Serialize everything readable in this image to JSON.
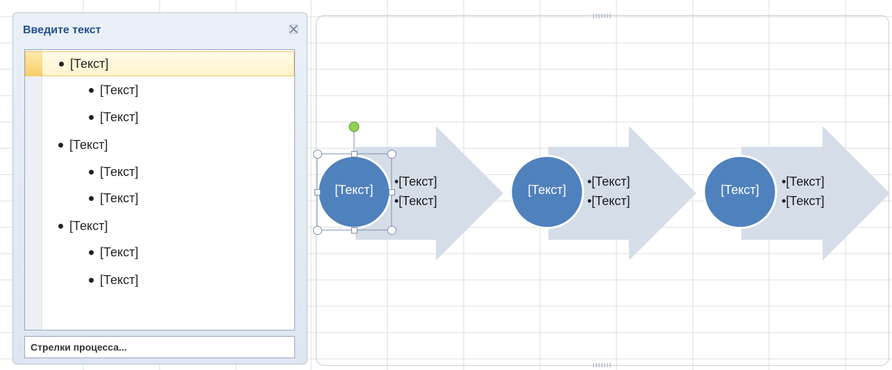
{
  "text_pane": {
    "title": "Введите текст",
    "close_icon": "close-x-icon",
    "items": [
      {
        "level": 1,
        "text": "[Текст]",
        "selected": true
      },
      {
        "level": 2,
        "text": "[Текст]"
      },
      {
        "level": 2,
        "text": "[Текст]"
      },
      {
        "level": 1,
        "text": "[Текст]"
      },
      {
        "level": 2,
        "text": "[Текст]"
      },
      {
        "level": 2,
        "text": "[Текст]"
      },
      {
        "level": 1,
        "text": "[Текст]"
      },
      {
        "level": 2,
        "text": "[Текст]"
      },
      {
        "level": 2,
        "text": "[Текст]"
      }
    ],
    "layout_name": "Стрелки процесса..."
  },
  "diagram": {
    "steps": [
      {
        "circle_text": "[Текст]",
        "lines": [
          "•[Текст]",
          "•[Текст]"
        ],
        "selected": true
      },
      {
        "circle_text": "[Текст]",
        "lines": [
          "•[Текст]",
          "•[Текст]"
        ]
      },
      {
        "circle_text": "[Текст]",
        "lines": [
          "•[Текст]",
          "•[Текст]"
        ]
      }
    ],
    "colors": {
      "circle": "#4f81bd",
      "arrow": "#d5dde9",
      "rotate_handle": "#8fd14f",
      "grid": "#d9d9d9"
    }
  }
}
